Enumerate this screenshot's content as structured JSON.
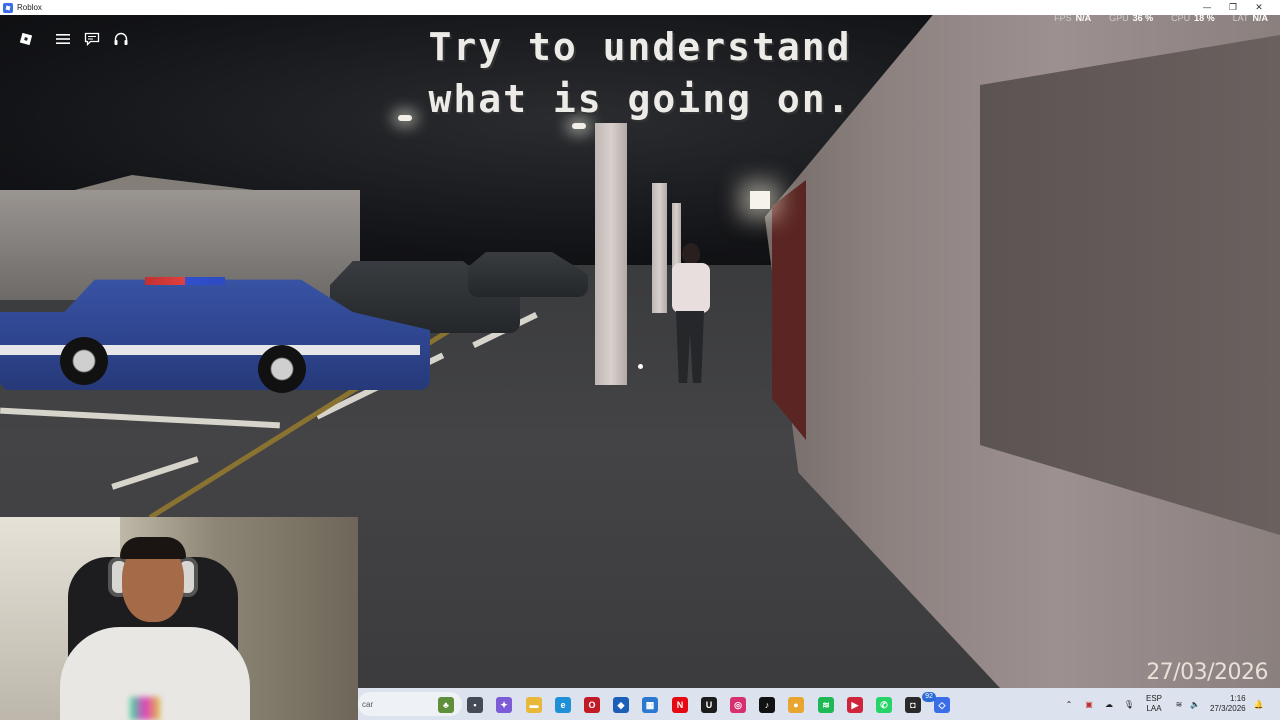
{
  "window": {
    "title": "Roblox",
    "minimize_glyph": "—",
    "maximize_glyph": "❐",
    "close_glyph": "✕"
  },
  "game": {
    "message_line1": "Try to understand",
    "message_line2": "what is going on.",
    "menu_icons": [
      "roblox-logo-icon",
      "hamburger-menu-icon",
      "chat-icon",
      "headphones-icon"
    ]
  },
  "stats": {
    "fps_label": "FPS",
    "fps_value": "N/A",
    "gpu_label": "GPU",
    "gpu_value": "36 %",
    "cpu_label": "CPU",
    "cpu_value": "18 %",
    "lat_label": "LAT",
    "lat_value": "N/A"
  },
  "overlay": {
    "date_watermark": "27/03/2026"
  },
  "taskbar": {
    "search_text": "car",
    "apps": [
      {
        "name": "widgets-icon",
        "color": "#5f8f3a",
        "glyph": "♣"
      },
      {
        "name": "task-view-icon",
        "color": "#444b55",
        "glyph": "▪"
      },
      {
        "name": "copilot-icon",
        "color": "#7b5cd6",
        "glyph": "✦"
      },
      {
        "name": "file-explorer-icon",
        "color": "#e8b83a",
        "glyph": "▬"
      },
      {
        "name": "edge-icon",
        "color": "#1f8fd6",
        "glyph": "e"
      },
      {
        "name": "opera-icon",
        "color": "#c21a26",
        "glyph": "O"
      },
      {
        "name": "security-icon",
        "color": "#1c5fb8",
        "glyph": "◆"
      },
      {
        "name": "store-icon",
        "color": "#2b78d0",
        "glyph": "▦"
      },
      {
        "name": "netflix-icon",
        "color": "#e50914",
        "glyph": "N"
      },
      {
        "name": "upwork-icon",
        "color": "#1c1c1c",
        "glyph": "U"
      },
      {
        "name": "instagram-icon",
        "color": "#d6306e",
        "glyph": "◎"
      },
      {
        "name": "tiktok-icon",
        "color": "#111111",
        "glyph": "♪"
      },
      {
        "name": "chrome-icon",
        "color": "#e8a530",
        "glyph": "●"
      },
      {
        "name": "spotify-icon",
        "color": "#1db954",
        "glyph": "≋"
      },
      {
        "name": "video-app-icon",
        "color": "#d0243a",
        "glyph": "▶"
      },
      {
        "name": "whatsapp-icon",
        "color": "#25d366",
        "glyph": "✆"
      },
      {
        "name": "android-icon",
        "color": "#2a2a2a",
        "glyph": "◘"
      },
      {
        "name": "roblox-taskbar-icon",
        "color": "#3a6ee8",
        "glyph": "◇"
      }
    ],
    "whatsapp_badge": "92",
    "language_top": "ESP",
    "language_bottom": "LAA",
    "time": "1:16",
    "date": "27/3/2026"
  }
}
